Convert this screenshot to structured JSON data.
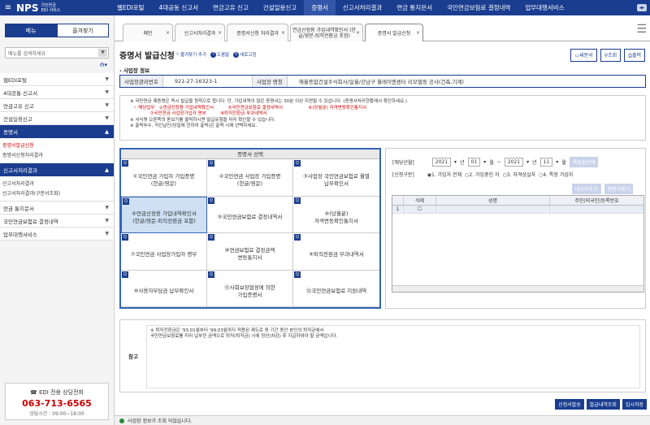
{
  "topbar": {
    "logo": "NPS",
    "logo_sub1": "국민연금",
    "logo_sub2": "EDI 서비스",
    "nav": [
      "웹EDI포털",
      "4대공동 신고서",
      "연금고유 신고",
      "건설일용신고",
      "증명서",
      "신고서처리결과",
      "연금 통지문서",
      "국민연금보험료 결정내역",
      "업무대행서비스"
    ],
    "active_nav": "증명서"
  },
  "sidebar": {
    "tab_menu": "메뉴",
    "tab_fav": "즐겨찾기",
    "search_placeholder": "메뉴를 검색하세요",
    "items_top": [
      "웹EDI포털",
      "4대공통 신고서",
      "연금고유 신고",
      "건설일용신고"
    ],
    "cert_head": "증명서",
    "cert_subs": [
      "증명서발급신청",
      "증명서신청처리결과"
    ],
    "result_head": "신고서처리결과",
    "result_subs": [
      "신고서처리결과",
      "신고서처리결과(구문서조회)"
    ],
    "items_bottom": [
      "연금 통지문서",
      "국민연금보험료 결정내역",
      "업무대행서비스"
    ],
    "help_title": "☎ EDI 전용 상담전화",
    "help_phone": "063-713-6565",
    "help_hours": "상담시간 : 09:00~18:00"
  },
  "tabs": [
    {
      "label": "메인"
    },
    {
      "label": "신고서처리결과"
    },
    {
      "label": "증명서신청 처리결과"
    },
    {
      "label": "연금산정용 가입내역확인서 (한글/영문-퇴직전환금 포함)"
    },
    {
      "label": "증명서 발급신청"
    }
  ],
  "page": {
    "title": "증명서 발급신청",
    "link_fav": "즐겨찾기 추가",
    "link_help": "도움말",
    "link_refresh": "새로고침",
    "btn_new": "새문서",
    "btn_search": "조회",
    "btn_print": "출력",
    "section_label": "사업장 정보",
    "biz_no_label": "사업장관리번호",
    "biz_no": "921-27-16323-1",
    "biz_name_label": "사업장 명칭",
    "biz_name": "해율종합건설주식회사/일율/강남구 월레이엔센터 리모델링 공사(건축,기계)"
  },
  "notice": [
    "※ 국민연금 제증명은 즉시 발급을 원칙으로 합니다. 단, 가입내역이 많은 증명서는 30분 이상 지연될 수 있습니다. (증명서처리현황에서 확인하세요.)",
    "  ☞ 해당업무   ①연금산정용 가입내역확인서          ⑤국민연금보험료 결정내역서                  ⑥(당월분) 자격변동확인통지서",
    "              ⑦국민연금 사업장가입자 명부          ⑧퇴직전환금 부과내역서",
    "※ 서식명 오른쪽의 돋보기를 클릭하시면 발급유형을 미리 확인할 수 있습니다.",
    "※ 출력부수, 직인날인(당일에 한하여 출력)은 출력 시에 선택하세요."
  ],
  "certs": {
    "header": "증명서 선택",
    "items": [
      "①국민연금 가입자 가입증명\n(한글/영문)",
      "②국민연금 사업장 가입증명\n(한글/영문)",
      "③사업장 국민연금보험료 월별\n납부확인서",
      "④연금산정용 가입내역확인서\n(한글/영문-퇴직전환금 포함)",
      "⑤국민연금보험료 결정내역서",
      "⑥(당월분)\n자격변동확인통지서",
      "⑦국민연금 사업장가입자 명부",
      "⑧연금보험료 결정금액\n변동통지서",
      "⑨퇴직전환금 부과내역서",
      "⑩사용자부담금 납부확인서",
      "⑪사회보장협정에 의한\n가입증명서",
      "⑫국민연금보험료 지원내역"
    ],
    "selected_index": 3
  },
  "right": {
    "period_label": "[해당년월]",
    "year_from": "2021",
    "month_from": "01",
    "year_to": "2021",
    "month_to": "11",
    "unit_year": "년",
    "unit_month": "월",
    "tilde": "~",
    "btn_special": "특정월선택",
    "type_label": "[신청구분]",
    "options": [
      "1. 가입자 전체",
      "2. 가입중인 자",
      "3. 자격상실자",
      "4. 특정 가입자"
    ],
    "btn_add": "대상자추가",
    "btn_del": "행정삭제기",
    "col_del": "삭제",
    "col_name": "성명",
    "col_id": "주민(외국인)등록번호",
    "row_no": "1"
  },
  "note": {
    "label": "참고",
    "line1": "※ 퇴직전환금은 '93.01월부터 '99.03월까지 적용된 제도로 동 기간 동안 본인의 퇴직금에서",
    "line2": "국민연금보험료를 미리 납부한 금액으로 퇴직(퇴직금) 시에 정산(차감) 후 지급하여야 할 금액입니다."
  },
  "bottom": {
    "btn1": "신청서발송",
    "btn2": "발급내역조회",
    "btn3": "임시저장"
  },
  "status": "사업장 정보가 조회 되었습니다."
}
